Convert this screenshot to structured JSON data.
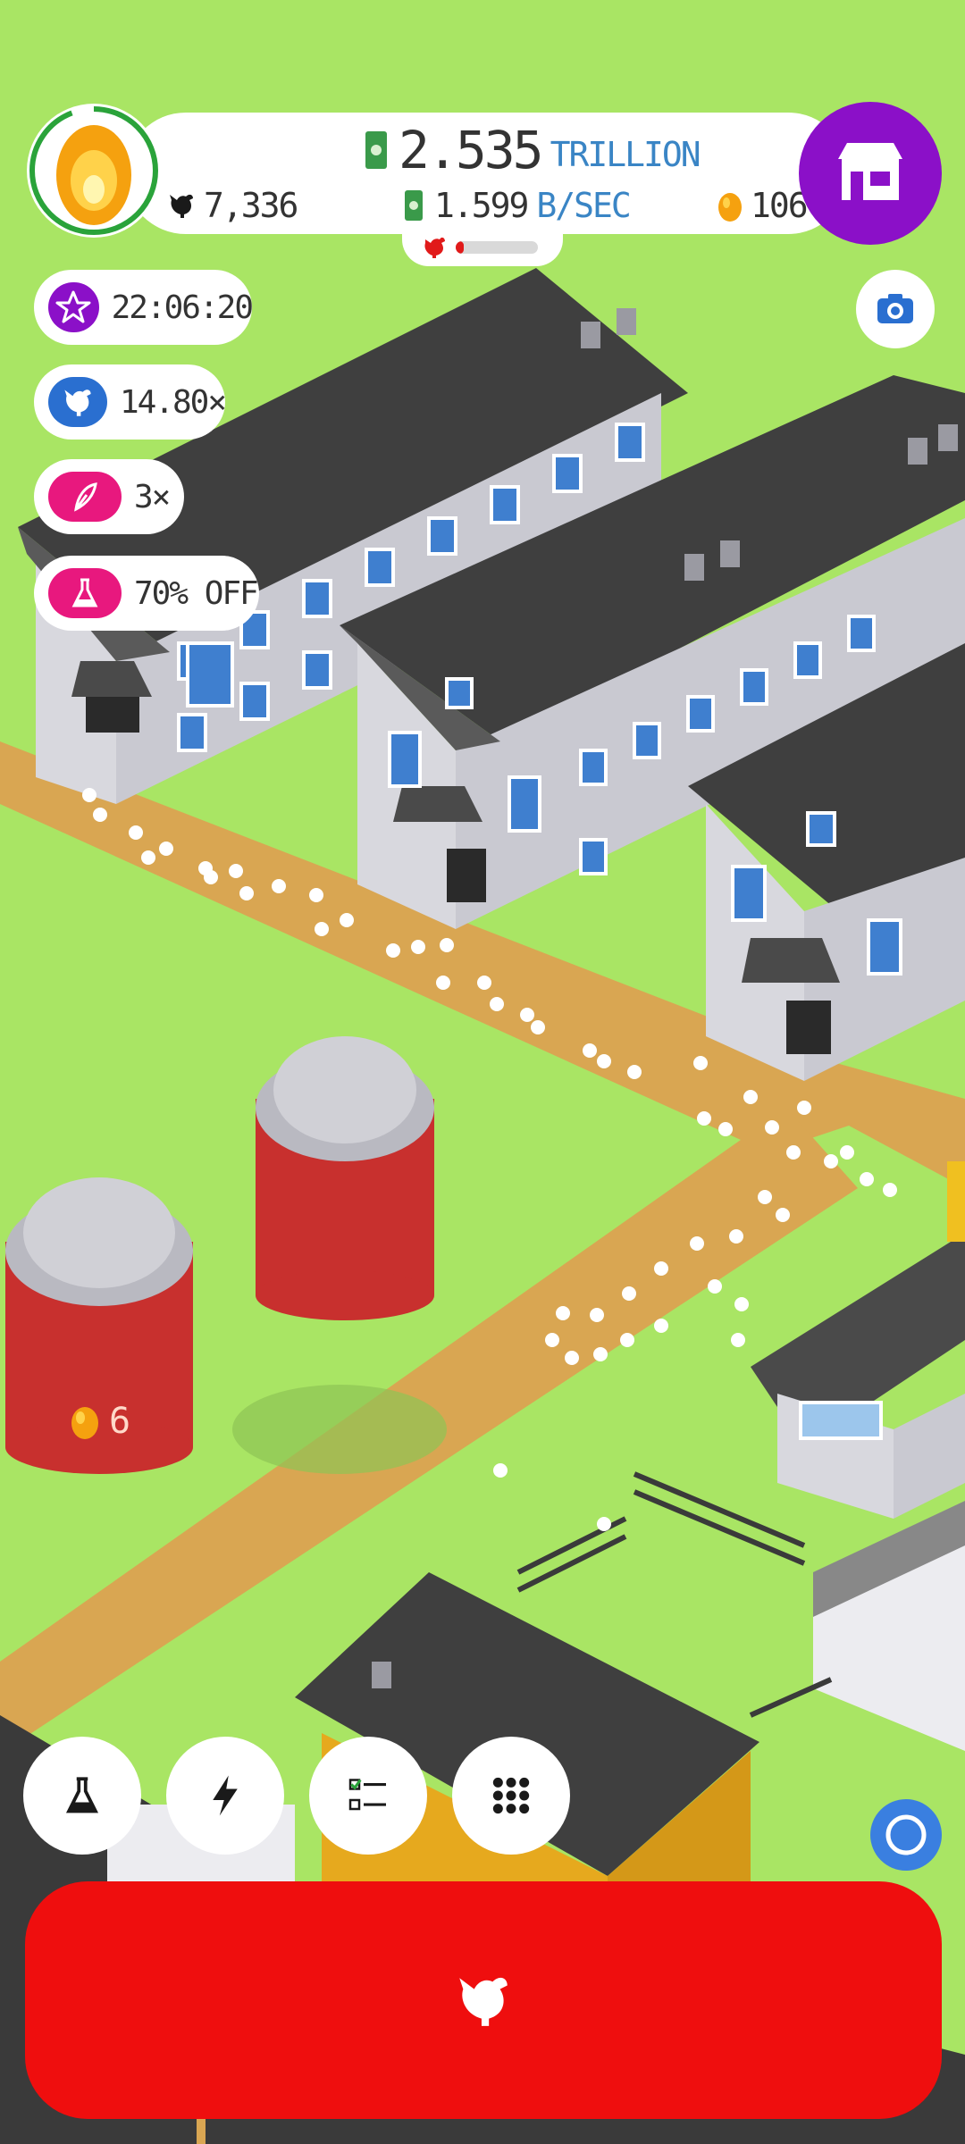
{
  "header": {
    "money_value": "2.535",
    "money_unit": "TRILLION",
    "rate_value": "1.599",
    "rate_unit": "B/SEC",
    "chicken_count": "7,336",
    "egg_count": "106",
    "progress_fraction": 0.1
  },
  "boosts": [
    {
      "icon": "star-icon",
      "label": "22:06:20",
      "color": "#8b10c8"
    },
    {
      "icon": "chicken-icon",
      "label": "14.80×",
      "color": "#2a6fd0"
    },
    {
      "icon": "feather-icon",
      "label": "3×",
      "color": "#e8187e"
    },
    {
      "icon": "flask-icon",
      "label": "70% OFF",
      "color": "#e8187e"
    }
  ],
  "silo": {
    "egg_value": "6"
  },
  "bottom_buttons": [
    "flask-icon",
    "lightning-icon",
    "checklist-icon",
    "grid-icon"
  ],
  "colors": {
    "shop": "#8b10c8",
    "hatch": "#ef0e0e",
    "grass": "#a9e564",
    "road": "#d9a652"
  }
}
